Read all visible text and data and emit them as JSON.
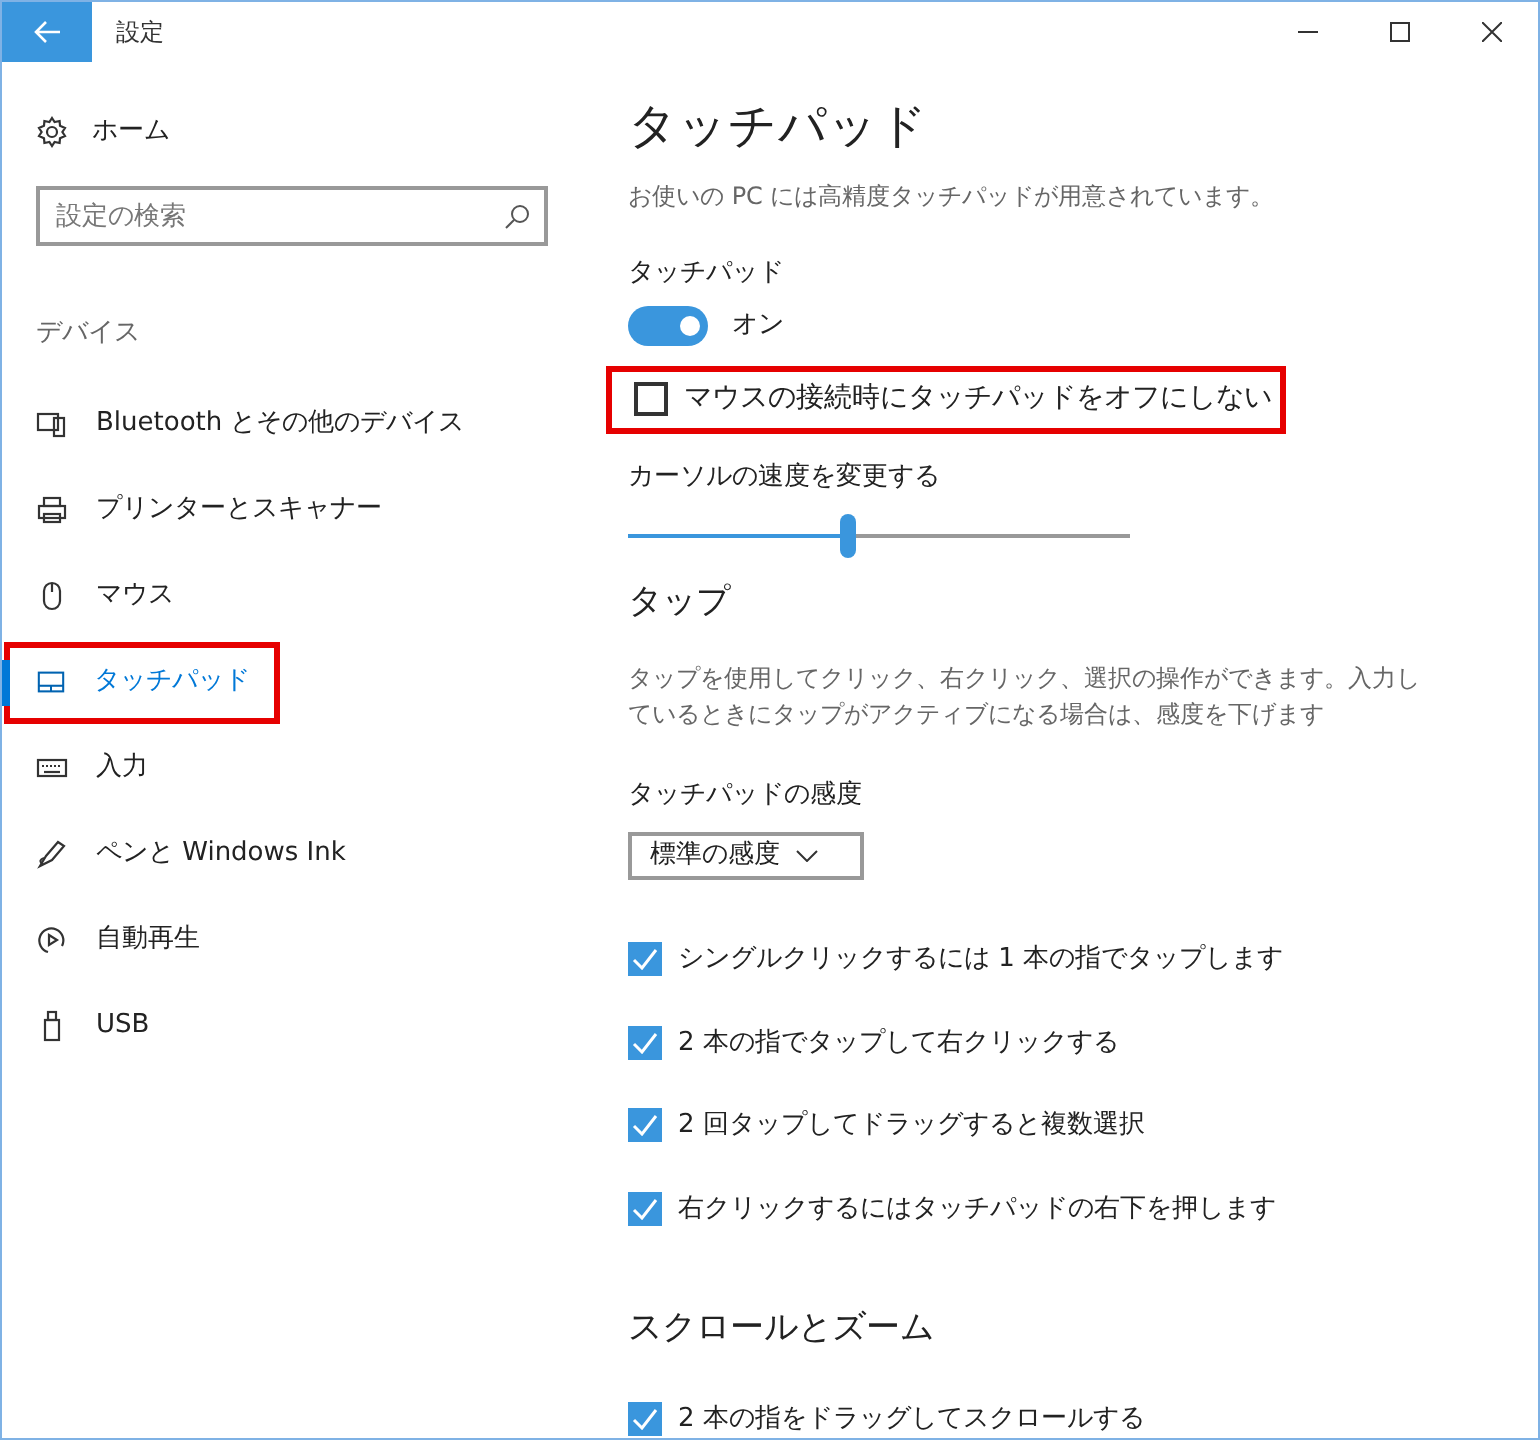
{
  "window": {
    "title": "設定"
  },
  "sidebar": {
    "home": "ホーム",
    "search": {
      "placeholder": "設定の検索"
    },
    "section": "デバイス",
    "items": [
      {
        "label": "Bluetooth とその他のデバイス",
        "kind": "bluetooth",
        "selected": false,
        "highlighted": false
      },
      {
        "label": "プリンターとスキャナー",
        "kind": "printer",
        "selected": false,
        "highlighted": false
      },
      {
        "label": "マウス",
        "kind": "mouse",
        "selected": false,
        "highlighted": false
      },
      {
        "label": "タッチパッド",
        "kind": "touchpad",
        "selected": true,
        "highlighted": true
      },
      {
        "label": "入力",
        "kind": "keyboard",
        "selected": false,
        "highlighted": false
      },
      {
        "label": "ペンと Windows Ink",
        "kind": "pen",
        "selected": false,
        "highlighted": false
      },
      {
        "label": "自動再生",
        "kind": "autoplay",
        "selected": false,
        "highlighted": false
      },
      {
        "label": "USB",
        "kind": "usb",
        "selected": false,
        "highlighted": false
      }
    ]
  },
  "content": {
    "title": "タッチパッド",
    "description": "お使いの PC には高精度タッチパッドが用意されています。",
    "toggle": {
      "label": "タッチパッド",
      "on": true,
      "state_text": "オン"
    },
    "keep_on_checkbox": {
      "label": "マウスの接続時にタッチパッドをオフにしない",
      "checked": false,
      "highlighted": true
    },
    "cursor_speed": {
      "label": "カーソルの速度を変更する",
      "level": 0.44
    },
    "tap_section": {
      "title": "タップ",
      "description": "タップを使用してクリック、右クリック、選択の操作ができます。入力しているときにタップがアクティブになる場合は、感度を下げます",
      "sensitivity": {
        "label": "タッチパッドの感度",
        "value": "標準の感度"
      },
      "options": [
        {
          "label": "シングルクリックするには 1 本の指でタップします",
          "checked": true
        },
        {
          "label": "2 本の指でタップして右クリックする",
          "checked": true
        },
        {
          "label": "2 回タップしてドラッグすると複数選択",
          "checked": true
        },
        {
          "label": "右クリックするにはタッチパッドの右下を押します",
          "checked": true
        }
      ]
    },
    "scroll_section": {
      "title": "スクロールとズーム",
      "options": [
        {
          "label": "2 本の指をドラッグしてスクロールする",
          "checked": true
        }
      ]
    }
  }
}
